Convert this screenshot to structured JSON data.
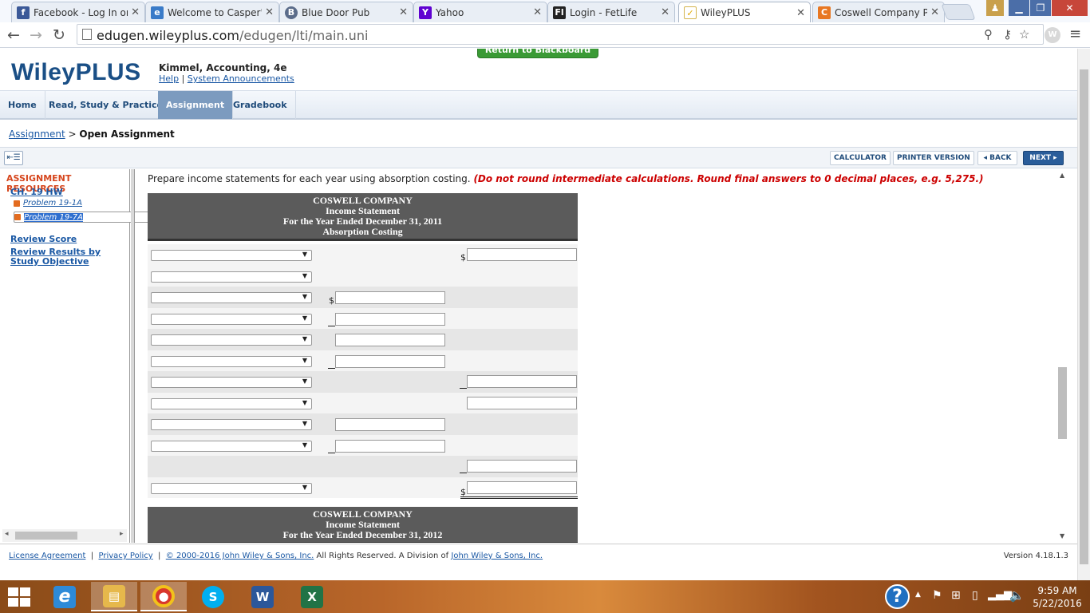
{
  "browser": {
    "tabs": [
      {
        "title": "Facebook - Log In or",
        "icon": "facebook-icon",
        "color": "#3b5998",
        "glyph": "f"
      },
      {
        "title": "Welcome to Casper's",
        "icon": "ie-page-icon",
        "color": "#3a7bc8",
        "glyph": "e"
      },
      {
        "title": "Blue Door Pub",
        "icon": "pub-icon",
        "color": "#5b6c8a",
        "glyph": "B"
      },
      {
        "title": "Yahoo",
        "icon": "yahoo-icon",
        "color": "#5f01d1",
        "glyph": "Y"
      },
      {
        "title": "Login - FetLife",
        "icon": "fetlife-icon",
        "color": "#222222",
        "glyph": "Fl"
      },
      {
        "title": "WileyPLUS",
        "icon": "wileyplus-check-icon",
        "color": "#f0c419",
        "glyph": "✓"
      },
      {
        "title": "Coswell Company Pr",
        "icon": "chegg-icon",
        "color": "#e87722",
        "glyph": "C"
      }
    ],
    "url_host": "edugen.wileyplus.com",
    "url_path": "/edugen/lti/main.uni"
  },
  "app": {
    "logo": "WileyPLUS",
    "course_title": "Kimmel, Accounting, 4e",
    "help_link": "Help",
    "link_sep": "|",
    "announcements_link": "System Announcements",
    "return_button": "Return to Blackboard"
  },
  "nav": [
    "Home",
    "Read, Study & Practice",
    "Assignment",
    "Gradebook"
  ],
  "breadcrumb": {
    "link": "Assignment",
    "sep": ">",
    "current": "Open Assignment"
  },
  "toolbar": {
    "collapse": "⇤☰",
    "calculator": "CALCULATOR",
    "printer": "PRINTER VERSION",
    "back": "◂ BACK",
    "next": "NEXT ▸"
  },
  "sidebar": {
    "title": "ASSIGNMENT RESOURCES",
    "chapter": "CH. 19 HW",
    "problems": [
      "Problem 19-1A",
      "Problem 19-7A"
    ],
    "review_score": "Review Score",
    "review_results": "Review Results by Study Objective"
  },
  "content": {
    "instruction": "Prepare income statements for each year using absorption costing.",
    "instruction_red": "(Do not round intermediate calculations. Round final answers to 0 decimal places, e.g. 5,275.)",
    "currency": "$",
    "statement1": {
      "company": "COSWELL COMPANY",
      "name": "Income Statement",
      "period": "For the Year Ended December 31, 2011",
      "method": "Absorption Costing"
    },
    "statement2": {
      "company": "COSWELL COMPANY",
      "name": "Income Statement",
      "period": "For the Year Ended December 31, 2012"
    }
  },
  "footer": {
    "license": "License Agreement",
    "privacy": "Privacy Policy",
    "sep": "|",
    "copyright_link": "© 2000-2016 John Wiley & Sons, Inc.",
    "rights": "All Rights Reserved. A Division of",
    "division_link": "John Wiley & Sons, Inc.",
    "version": "Version 4.18.1.3"
  },
  "taskbar": {
    "apps": [
      {
        "name": "internet-explorer",
        "glyph": "e",
        "color": "#2d8ad8"
      },
      {
        "name": "file-explorer",
        "glyph": "▤",
        "color": "#e6b84b"
      },
      {
        "name": "chrome",
        "glyph": "◉",
        "color": "#d9372c"
      },
      {
        "name": "skype",
        "glyph": "S",
        "color": "#00aff0"
      },
      {
        "name": "word",
        "glyph": "W",
        "color": "#2b579a"
      },
      {
        "name": "excel",
        "glyph": "X",
        "color": "#217346"
      }
    ],
    "time": "9:59 AM",
    "date": "5/22/2016"
  }
}
